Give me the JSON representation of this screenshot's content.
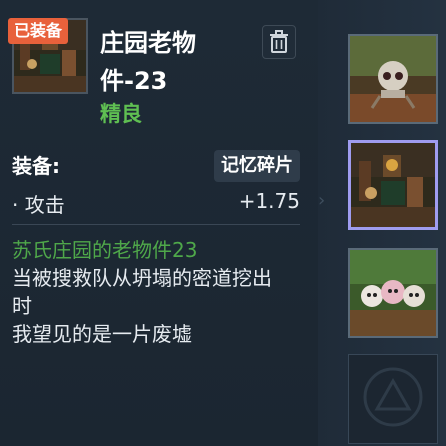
{
  "item": {
    "equipped_badge": "已装备",
    "title": "庄园老物件-23",
    "rarity": "精良"
  },
  "equip": {
    "label": "装备:",
    "tag": "记忆碎片"
  },
  "stats": [
    {
      "name": "· 攻击",
      "value": "+1.75"
    }
  ],
  "description": {
    "name": "苏氏庄园的老物件23",
    "lines": [
      "当被搜救队从坍塌的密道挖出",
      "时",
      "我望见的是一片废墟"
    ]
  },
  "side_slots": [
    {
      "icon": "robot-item-icon"
    },
    {
      "icon": "manor-item-icon"
    },
    {
      "icon": "animals-item-icon"
    },
    {
      "icon": "empty-slot-icon"
    }
  ],
  "colors": {
    "badge": "#e8613b",
    "rarity": "#5fbf52",
    "description_name": "#4fa84a",
    "selected_border": "#9f9cf0"
  }
}
